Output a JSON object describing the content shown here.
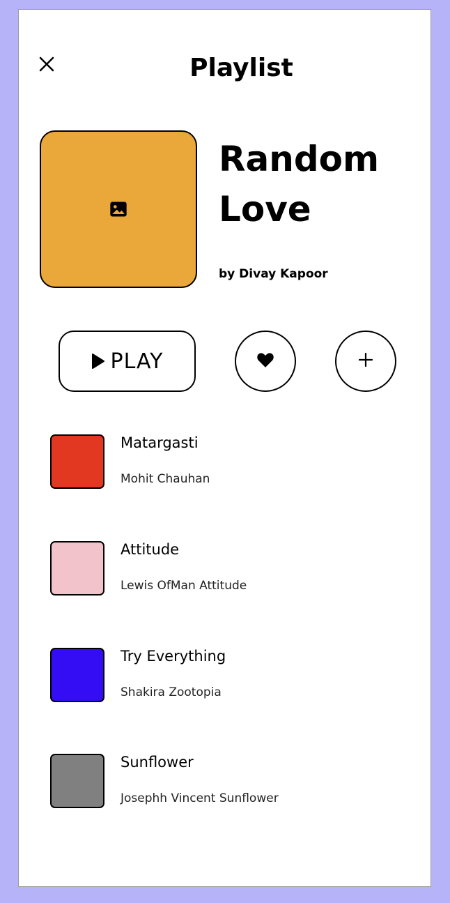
{
  "header": {
    "title": "Playlist",
    "close_icon": "close-icon"
  },
  "playlist": {
    "name": "Random Love",
    "author": "by Divay Kapoor",
    "cover_color": "#eba83a",
    "cover_icon": "image-icon"
  },
  "actions": {
    "play_label": "PLAY",
    "play_icon": "play-icon",
    "like_icon": "heart-icon",
    "add_icon": "plus-icon"
  },
  "tracks": [
    {
      "title": "Matargasti",
      "artist": "Mohit Chauhan",
      "color": "#e23822"
    },
    {
      "title": "Attitude",
      "artist": "Lewis OfMan Attitude",
      "color": "#f2c3cb"
    },
    {
      "title": "Try Everything",
      "artist": "Shakira Zootopia",
      "color": "#340df5"
    },
    {
      "title": "Sunflower",
      "artist": "Josephh Vincent Sunflower",
      "color": "#808080"
    }
  ]
}
